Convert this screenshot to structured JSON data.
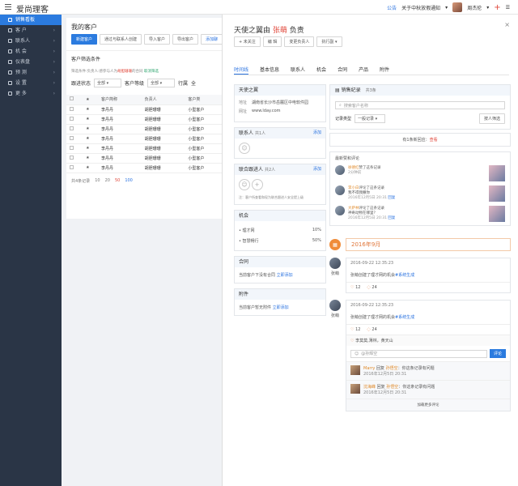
{
  "app": {
    "title": "爱尚理客"
  },
  "topbar": {
    "notice": "公告",
    "about": "关于中秋放假通知",
    "user": "周杰伦"
  },
  "sidebar": {
    "items": [
      {
        "label": "销售看板",
        "active": true
      },
      {
        "label": "客 户"
      },
      {
        "label": "联系人"
      },
      {
        "label": "机 会"
      },
      {
        "label": "仪表盘"
      },
      {
        "label": "预 测"
      },
      {
        "label": "设 置"
      },
      {
        "label": "更 多"
      }
    ]
  },
  "list": {
    "title": "我的客户",
    "buttons": [
      "新建客户",
      "通过与联系人创建",
      "导入客户",
      "导出客户",
      "添加聊"
    ],
    "filter_title": "客户筛选条件",
    "filter_hint_prefix": "筛选条件:负责人:感参与人为",
    "filter_hint_red": "胡胆珊珊",
    "filter_hint_mid": "的合同",
    "filter_hint_cancel": "取消筛选",
    "status_label": "跟进状态",
    "status_value": "全部",
    "level_label": "客户等级",
    "level_value": "全部",
    "industry_label": "行属",
    "industry_value": "全",
    "columns": [
      "",
      "",
      "客户简称",
      "负责人",
      "客户类"
    ],
    "rows": [
      [
        "李丹丹",
        "胡胆珊珊",
        "小型客户"
      ],
      [
        "李丹丹",
        "胡胆珊珊",
        "小型客户"
      ],
      [
        "李丹丹",
        "胡胆珊珊",
        "小型客户"
      ],
      [
        "李丹丹",
        "胡胆珊珊",
        "小型客户"
      ],
      [
        "李丹丹",
        "胡胆珊珊",
        "小型客户"
      ],
      [
        "李丹丹",
        "胡胆珊珊",
        "小型客户"
      ],
      [
        "李丹丹",
        "胡胆珊珊",
        "小型客户"
      ]
    ],
    "pager": {
      "total": "共4条记录",
      "sizes": [
        "10",
        "20",
        "50",
        "100"
      ]
    }
  },
  "detail": {
    "title_prefix": "天使之翼由",
    "title_owner": "张萌",
    "title_suffix": "负责",
    "buttons": [
      "+ 未关注",
      "编 辑",
      "变更负责人",
      "执行副"
    ],
    "tabs": [
      "时间线",
      "基本信息",
      "联系人",
      "机会",
      "合同",
      "产品",
      "附件"
    ],
    "company": {
      "title": "天使之翼",
      "addr_label": "地址",
      "addr": "湖南省长沙市岳麓区中电软件园",
      "web_label": "网址",
      "web": "www.lday.com"
    },
    "contacts": {
      "title": "联系人",
      "count": "共1人",
      "add": "添加"
    },
    "followers": {
      "title": "联合跟进人",
      "count": "共2人",
      "add": "添加",
      "note": "注：客户所查看和现为联合跟进人安全提上级"
    },
    "opps": {
      "title": "机会",
      "items": [
        {
          "name": "理才网",
          "pct": "10%"
        },
        {
          "name": "智慧畅行",
          "pct": "50%"
        }
      ]
    },
    "contract": {
      "title": "合同",
      "empty": "当前客户下没有合同",
      "add": "立即添加"
    },
    "attach": {
      "title": "附件",
      "empty": "当前客户暂无附件",
      "add": "立即添加"
    },
    "sales": {
      "title": "销售纪录",
      "count": "共3条",
      "search_placeholder": "搜索客户名称",
      "type_label": "记录类型",
      "type_value": "一般记录",
      "filter_btn": "按人筛选"
    },
    "unread_prefix": "有1条新回应：",
    "unread_link": "查看",
    "recent": {
      "title": "最新赞和评论",
      "items": [
        {
          "name": "徐德红",
          "action": "赞了这条记录",
          "text": "",
          "time": "2分钟前"
        },
        {
          "name": "李小白",
          "action": "评论了这条记录",
          "text": "我不得我撒你",
          "time": "2016年12月5日 20:31",
          "reply": "回复"
        },
        {
          "name": "大萨林",
          "action": "评论了这条记录",
          "text": "神奇动物在哪里？",
          "time": "2016年12月5日 20:31",
          "reply": "回复"
        }
      ]
    },
    "timeline": {
      "year": "2016年9月",
      "entries": [
        {
          "time": "2016-09-22 12:35:23",
          "user": "张萌",
          "text_prefix": "张萌创建了理才网的机会",
          "text_link": "#系统生成",
          "likes": "12",
          "comments": "24"
        },
        {
          "time": "2016-09-22 12:35:23",
          "user": "张萌",
          "text_prefix": "张萌创建了理才网的机会",
          "text_link": "#系统生成",
          "likes": "12",
          "comments": "24",
          "liked_by": "李莫莫,薄林，黄天山",
          "reply_placeholder": "@孙辉空",
          "reply_btn": "评论",
          "subcomments": [
            {
              "name": "Marry",
              "verb": "回复",
              "to": "孙悟空",
              "text": "：你这条记录有问题",
              "time": "2016年12月5日 20:31"
            },
            {
              "name": "沈海峰",
              "verb": "回复",
              "to": "孙悟空",
              "text": "：你这条记录有问题",
              "time": "2016年12月5日 20:31"
            }
          ],
          "more": "加载更多评论"
        }
      ]
    }
  }
}
